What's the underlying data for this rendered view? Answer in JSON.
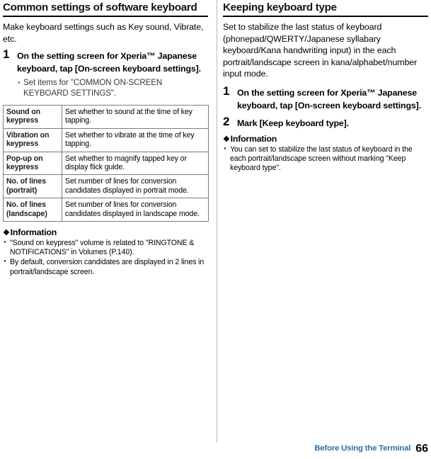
{
  "left": {
    "heading": "Common settings of software keyboard",
    "intro": "Make keyboard settings such as Key sound, Vibrate, etc.",
    "steps": [
      {
        "num": "1",
        "text": "On the setting screen for Xperia™ Japanese keyboard, tap [On-screen keyboard settings].",
        "bullets": [
          "Set items for \"COMMON ON-SCREEN KEYBOARD SETTINGS\"."
        ]
      }
    ],
    "table": {
      "rows": [
        {
          "label": "Sound on keypress",
          "desc": "Set whether to sound at the time of key tapping."
        },
        {
          "label": "Vibration on keypress",
          "desc": "Set whether to vibrate at the time of key tapping."
        },
        {
          "label": "Pop-up on keypress",
          "desc": "Set whether to magnify tapped key or display flick guide."
        },
        {
          "label": "No. of lines (portrait)",
          "desc": "Set number of lines for conversion candidates displayed in portrait mode."
        },
        {
          "label": "No. of lines (landscape)",
          "desc": "Set number of lines for conversion candidates displayed in landscape mode."
        }
      ]
    },
    "information": {
      "title": "Information",
      "items": [
        "\"Sound on keypress\" volume is related to \"RINGTONE & NOTIFICATIONS\" in Volumes (P.140).",
        "By default, conversion candidates are displayed in 2 lines in portrait/landscape screen."
      ]
    }
  },
  "right": {
    "heading": "Keeping keyboard type",
    "intro": "Set to stabilize the last status of keyboard (phonepad/QWERTY/Japanese syllabary keyboard/Kana handwriting input) in the each portrait/landscape screen in kana/alphabet/number input mode.",
    "steps": [
      {
        "num": "1",
        "text": "On the setting screen for Xperia™ Japanese keyboard, tap [On-screen keyboard settings]."
      },
      {
        "num": "2",
        "text": "Mark [Keep keyboard type]."
      }
    ],
    "information": {
      "title": "Information",
      "items": [
        "You can set to stabilize the last status of keyboard in the each portrait/landscape screen without marking \"Keep keyboard type\"."
      ]
    }
  },
  "footer": {
    "section_label": "Before Using the Terminal",
    "page_number": "66"
  }
}
